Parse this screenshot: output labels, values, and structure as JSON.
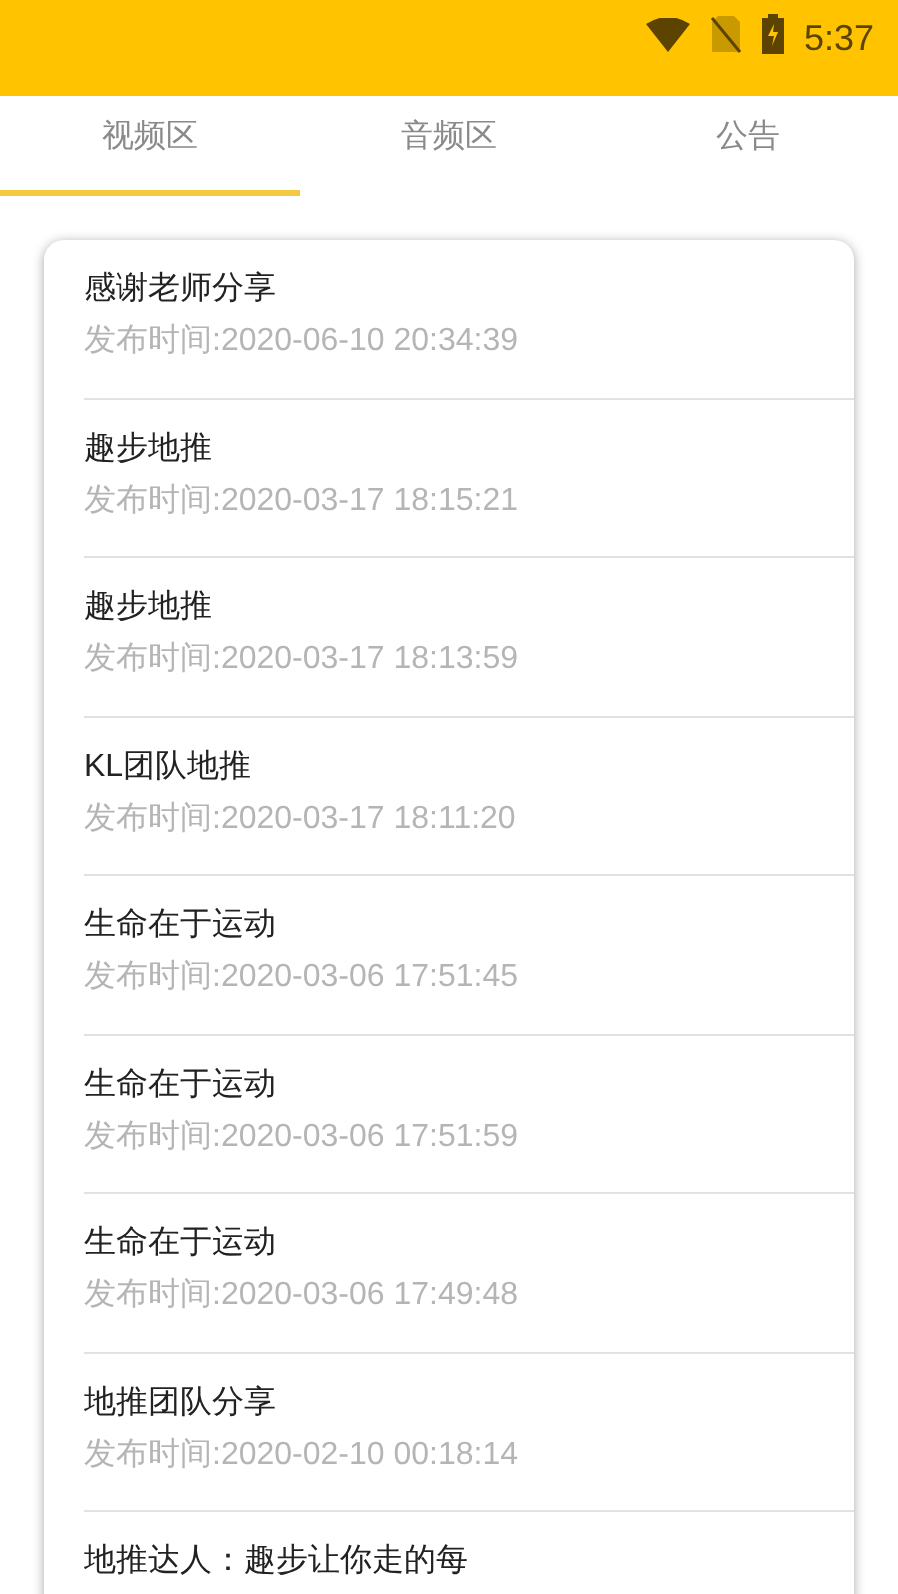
{
  "status_bar": {
    "time": "5:37"
  },
  "tabs": [
    {
      "label": "视频区",
      "selected": true
    },
    {
      "label": "音频区",
      "selected": false
    },
    {
      "label": "公告",
      "selected": false
    }
  ],
  "posts": [
    {
      "title": "感谢老师分享",
      "published": "发布时间:2020-06-10 20:34:39"
    },
    {
      "title": "趣步地推",
      "published": "发布时间:2020-03-17 18:15:21"
    },
    {
      "title": "趣步地推",
      "published": "发布时间:2020-03-17 18:13:59"
    },
    {
      "title": "KL团队地推",
      "published": "发布时间:2020-03-17 18:11:20"
    },
    {
      "title": "生命在于运动",
      "published": "发布时间:2020-03-06 17:51:45"
    },
    {
      "title": "生命在于运动",
      "published": "发布时间:2020-03-06 17:51:59"
    },
    {
      "title": "生命在于运动",
      "published": "发布时间:2020-03-06 17:49:48"
    },
    {
      "title": "地推团队分享",
      "published": "发布时间:2020-02-10 00:18:14"
    },
    {
      "title": "地推达人：趣步让你走的每"
    }
  ]
}
